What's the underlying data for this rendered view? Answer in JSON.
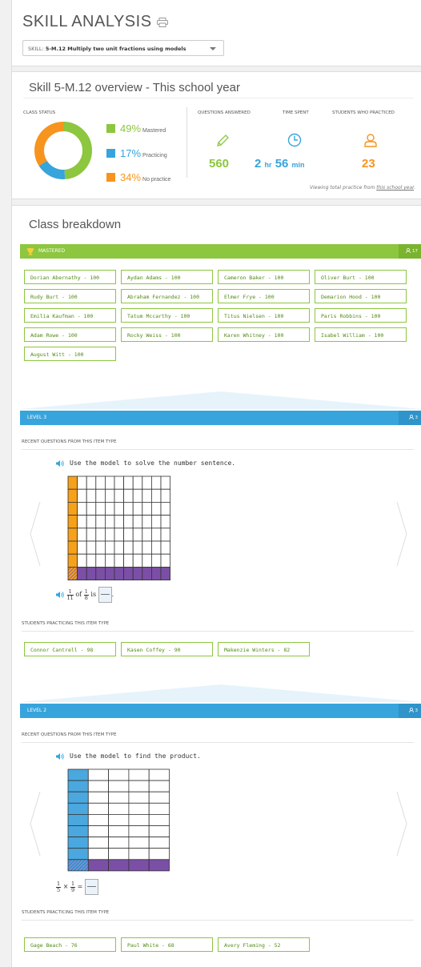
{
  "header": {
    "title": "SKILL ANALYSIS",
    "skill_prefix": "SKILL:",
    "skill_value": "5-M.12 Multiply two unit fractions using models"
  },
  "overview": {
    "title": "Skill 5-M.12 overview - This school year",
    "class_status_label": "CLASS STATUS",
    "mastered_pct": "49%",
    "mastered_label": "Mastered",
    "practicing_pct": "17%",
    "practicing_label": "Practicing",
    "nopractice_pct": "34%",
    "nopractice_label": "No practice",
    "questions_label": "QUESTIONS ANSWERED",
    "time_label": "TIME SPENT",
    "students_label": "STUDENTS WHO PRACTICED",
    "questions_value": "560",
    "time_hr_value": "2",
    "time_hr_unit": "hr",
    "time_min_value": "56",
    "time_min_unit": "min",
    "students_value": "23",
    "viewing_prefix": "Viewing total practice from",
    "viewing_link": "this school year",
    "viewing_suffix": ".",
    "donut": {
      "mastered": 49,
      "practicing": 17,
      "nopractice": 34
    },
    "colors": {
      "mastered": "#8dc63f",
      "practicing": "#37a4dc",
      "nopractice": "#f7941d"
    }
  },
  "breakdown": {
    "title": "Class breakdown",
    "mastered": {
      "label": "MASTERED",
      "count": "17",
      "students": [
        "Dorian Abernathy - 100",
        "Aydan Adams - 100",
        "Cameron Baker - 100",
        "Oliver Burt - 100",
        "Rudy Burt - 100",
        "Abraham Fernandez - 100",
        "Elmer Frye - 100",
        "Demarion Hood - 100",
        "Emilia Kaufman - 100",
        "Tatum Mccarthy - 100",
        "Titus Nielsen - 100",
        "Paris Robbins - 100",
        "Adam Rowe - 100",
        "Rocky Weiss - 100",
        "Karen Whitney - 100",
        "Isabel William - 100",
        "August Witt - 100"
      ]
    },
    "level3": {
      "label": "LEVEL 3",
      "count": "3",
      "recent_label": "RECENT QUESTIONS FROM THIS ITEM TYPE",
      "question": "Use the model to solve the number sentence.",
      "frac1_n": "1",
      "frac1_d": "11",
      "of_text": "of",
      "frac2_n": "1",
      "frac2_d": "8",
      "is_text": "is",
      "end_text": ".",
      "practicing_label": "STUDENTS PRACTICING THIS ITEM TYPE",
      "students": [
        "Connor Cantrell - 98",
        "Kasen Coffey - 90",
        "Makenzie Winters - 82"
      ]
    },
    "level2": {
      "label": "LEVEL 2",
      "count": "3",
      "recent_label": "RECENT QUESTIONS FROM THIS ITEM TYPE",
      "question": "Use the model to find the product.",
      "frac1_n": "1",
      "frac1_d": "5",
      "times_text": "×",
      "frac2_n": "1",
      "frac2_d": "9",
      "eq_text": "=",
      "practicing_label": "STUDENTS PRACTICING THIS ITEM TYPE",
      "students": [
        "Gage Beach - 76",
        "Paul White - 68",
        "Avery Fleming - 52"
      ]
    }
  }
}
